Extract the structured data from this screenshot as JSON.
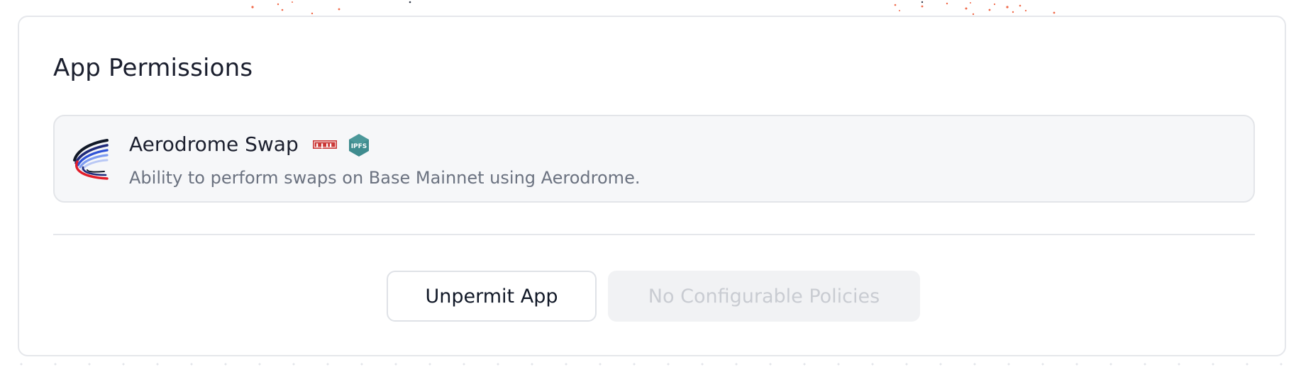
{
  "card": {
    "title": "App Permissions"
  },
  "permission": {
    "app_name": "Aerodrome Swap",
    "npm_badge": "npm",
    "ipfs_badge": "IPFS",
    "description": "Ability to perform swaps on Base Mainnet using Aerodrome.",
    "logo_icon": "aerodrome-logo-icon",
    "colors": {
      "npm": "#cb3837",
      "ipfs": "#3f8c8f"
    }
  },
  "actions": {
    "unpermit_label": "Unpermit App",
    "policies_label": "No Configurable Policies"
  },
  "colors": {
    "card_border": "#e5e7eb",
    "item_background": "#f6f7f9",
    "title_text": "#1b1f2e",
    "muted_text": "#6b7280",
    "disabled_button_bg": "#f1f2f4",
    "disabled_button_text": "#c9ccd2",
    "background_dots": "#e3e5ea",
    "accent_dots": "#f06a4a"
  }
}
